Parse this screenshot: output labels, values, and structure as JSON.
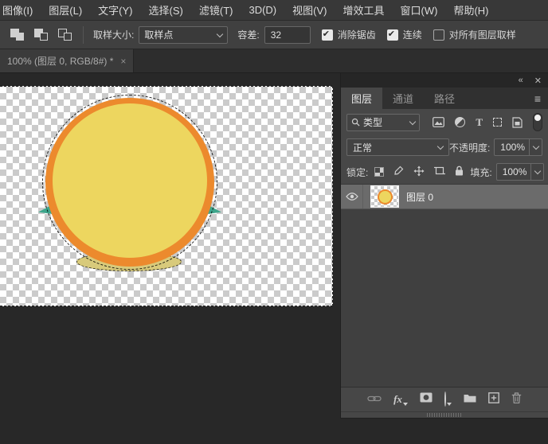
{
  "menu": {
    "items": [
      {
        "label": "图像(I)"
      },
      {
        "label": "图层(L)"
      },
      {
        "label": "文字(Y)"
      },
      {
        "label": "选择(S)"
      },
      {
        "label": "滤镜(T)"
      },
      {
        "label": "3D(D)"
      },
      {
        "label": "视图(V)"
      },
      {
        "label": "增效工具"
      },
      {
        "label": "窗口(W)"
      },
      {
        "label": "帮助(H)"
      }
    ]
  },
  "options_bar": {
    "sample_size_label": "取样大小:",
    "sample_size_value": "取样点",
    "tolerance_label": "容差:",
    "tolerance_value": "32",
    "anti_alias_label": "消除锯齿",
    "anti_alias_checked": true,
    "contiguous_label": "连续",
    "contiguous_checked": true,
    "sample_all_layers_label": "对所有图层取样",
    "sample_all_layers_checked": false
  },
  "document_tab": {
    "title": "100% (图层 0, RGB/8#) *",
    "close_glyph": "×"
  },
  "layers_panel": {
    "collapse_glyph": "«",
    "close_glyph": "✕",
    "menu_glyph": "≡",
    "tabs": [
      {
        "label": "图层"
      },
      {
        "label": "通道"
      },
      {
        "label": "路径"
      }
    ],
    "filter": {
      "type_label": "类型"
    },
    "blend_mode_value": "正常",
    "opacity_label": "不透明度:",
    "opacity_value": "100%",
    "lock_label": "锁定:",
    "fill_label": "填充:",
    "fill_value": "100%",
    "layers": [
      {
        "name": "图层 0",
        "visible": true
      }
    ],
    "footer": {
      "fx_label": "fx"
    }
  },
  "canvas": {
    "zoom_percent": "100%",
    "colors": {
      "circle_border": "#ec8a2d",
      "circle_fill": "#edd65f",
      "shadow": "#d8ca7b",
      "leaf_teal": "#3ea68c",
      "checker_gray": "#cbcbcb"
    }
  }
}
